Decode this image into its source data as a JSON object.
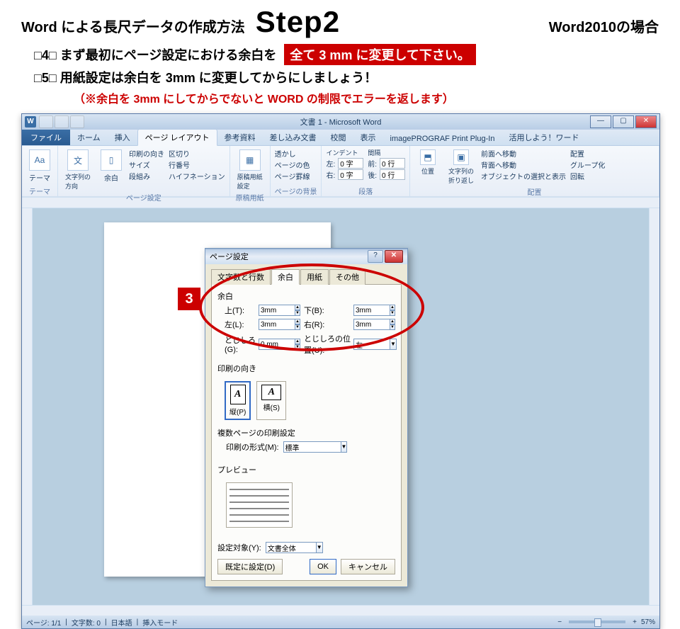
{
  "doc": {
    "title_left": "Word による長尺データの作成方法",
    "step_label": "Step2",
    "title_right": "Word2010の場合",
    "line4": "□4□ まず最初にページ設定における余白を",
    "line4_badge": "全て 3 mm に変更して下さい。",
    "line5": "□5□ 用紙設定は余白を 3mm に変更してからにしましょう！",
    "note": "（※余白を 3mm にしてからでないと WORD の制限でエラーを返します）",
    "callout_number": "3"
  },
  "word": {
    "titlebar": "文書 1 - Microsoft Word",
    "win": {
      "min": "—",
      "max": "▢",
      "close": "✕"
    },
    "file_tab": "ファイル",
    "tabs": [
      "ホーム",
      "挿入",
      "ページ レイアウト",
      "参考資料",
      "差し込み文書",
      "校閲",
      "表示",
      "imagePROGRAF Print Plug-In",
      "活用しよう！ワード"
    ],
    "active_tab_index": 2,
    "ribbon": {
      "theme": {
        "label": "テーマ",
        "btn1": "テーマ"
      },
      "page_setup": {
        "label": "ページ設定",
        "text_direction": "文字列の\n方向",
        "margins": "余白",
        "col1": [
          "印刷の向き",
          "サイズ",
          "段組み"
        ],
        "col2": [
          "区切り",
          "行番号",
          "ハイフネーション"
        ]
      },
      "genkoyoshi": {
        "label": "原稿用紙",
        "btn": "原稿用紙\n設定"
      },
      "background": {
        "label": "ページの背景",
        "items": [
          "透かし",
          "ページの色",
          "ページ罫線"
        ]
      },
      "paragraph": {
        "label": "段落",
        "indent_head": "インデント",
        "left_lbl": "左:",
        "left_val": "0 字",
        "right_lbl": "右:",
        "right_val": "0 字",
        "spacing_head": "間隔",
        "before_lbl": "前:",
        "before_val": "0 行",
        "after_lbl": "後:",
        "after_val": "0 行"
      },
      "arrange": {
        "label": "配置",
        "btn_position": "位置",
        "btn_wrap": "文字列の\n折り返し",
        "items": [
          "前面へ移動",
          "背面へ移動",
          "オブジェクトの選択と表示"
        ],
        "align": "配置",
        "group": "グループ化",
        "rotate": "回転"
      }
    },
    "dialog": {
      "title": "ページ設定",
      "help": "?",
      "close": "✕",
      "tabs": [
        "文字数と行数",
        "余白",
        "用紙",
        "その他"
      ],
      "active_tab_index": 1,
      "margins": {
        "group": "余白",
        "top_lbl": "上(T):",
        "top_val": "3mm",
        "bottom_lbl": "下(B):",
        "bottom_val": "3mm",
        "left_lbl": "左(L):",
        "left_val": "3mm",
        "right_lbl": "右(R):",
        "right_val": "3mm",
        "gutter_lbl": "とじしろ(G):",
        "gutter_val": "0 mm",
        "gutter_pos_lbl": "とじしろの位置(U):",
        "gutter_pos_val": "左"
      },
      "orientation": {
        "group": "印刷の向き",
        "portrait": "縦(P)",
        "landscape": "横(S)"
      },
      "multipage": {
        "group": "複数ページの印刷設定",
        "format_lbl": "印刷の形式(M):",
        "format_val": "標準"
      },
      "preview_label": "プレビュー",
      "apply_lbl": "設定対象(Y):",
      "apply_val": "文書全体",
      "set_default": "既定に設定(D)",
      "ok": "OK",
      "cancel": "キャンセル"
    },
    "status": {
      "page": "ページ: 1/1",
      "words": "文字数: 0",
      "lang": "日本語",
      "mode": "挿入モード",
      "zoom": "57%",
      "minus": "−",
      "plus": "+"
    }
  }
}
